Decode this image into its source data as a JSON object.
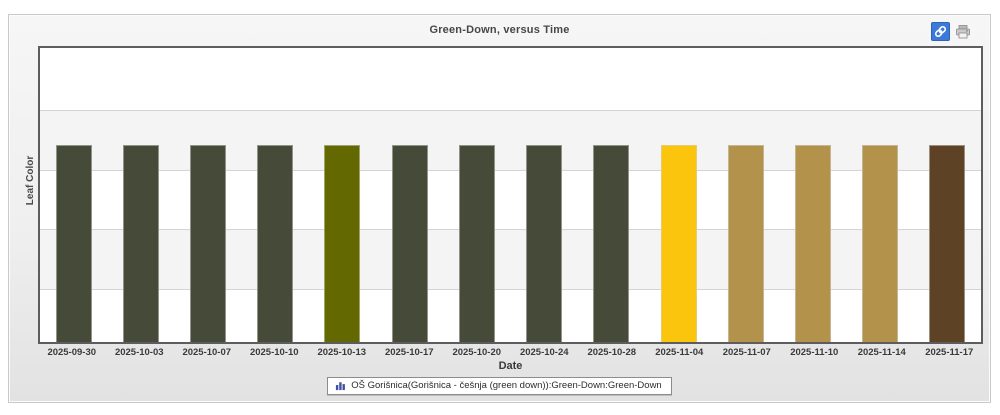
{
  "title": "Green-Down, versus Time",
  "toolbar": {
    "link_icon": "link-icon",
    "print_icon": "printer-icon",
    "link_button_color": "#3d79d8"
  },
  "legend": {
    "icon": "bar-chart-icon",
    "label": "OŠ Gorišnica(Gorišnica - češnja (green down)):Green-Down:Green-Down"
  },
  "chart_data": {
    "type": "bar",
    "title": "Green-Down, versus Time",
    "xlabel": "Date",
    "ylabel": "Leaf Color",
    "categories": [
      "2025-09-30",
      "2025-10-03",
      "2025-10-07",
      "2025-10-10",
      "2025-10-13",
      "2025-10-17",
      "2025-10-20",
      "2025-10-24",
      "2025-10-28",
      "2025-11-04",
      "2025-11-07",
      "2025-11-10",
      "2025-11-14",
      "2025-11-17"
    ],
    "series": [
      {
        "name": "OŠ Gorišnica(Gorišnica - češnja (green down)):Green-Down:Green-Down",
        "values": [
          1,
          1,
          1,
          1,
          1,
          1,
          1,
          1,
          1,
          1,
          1,
          1,
          1,
          1
        ],
        "bar_colors": [
          "#464b39",
          "#464b39",
          "#464b39",
          "#464b39",
          "#636800",
          "#464b39",
          "#464b39",
          "#464b39",
          "#464b39",
          "#fbc40d",
          "#b3924c",
          "#b3924c",
          "#b3924c",
          "#5e4226"
        ]
      }
    ],
    "bar_height_fraction": 0.67,
    "y_axis": "categorical, no tick labels; bar color encodes observed leaf color",
    "legend_position": "bottom",
    "grid": "horizontal alternating white/#f4f4f4 bands with light gridlines"
  }
}
